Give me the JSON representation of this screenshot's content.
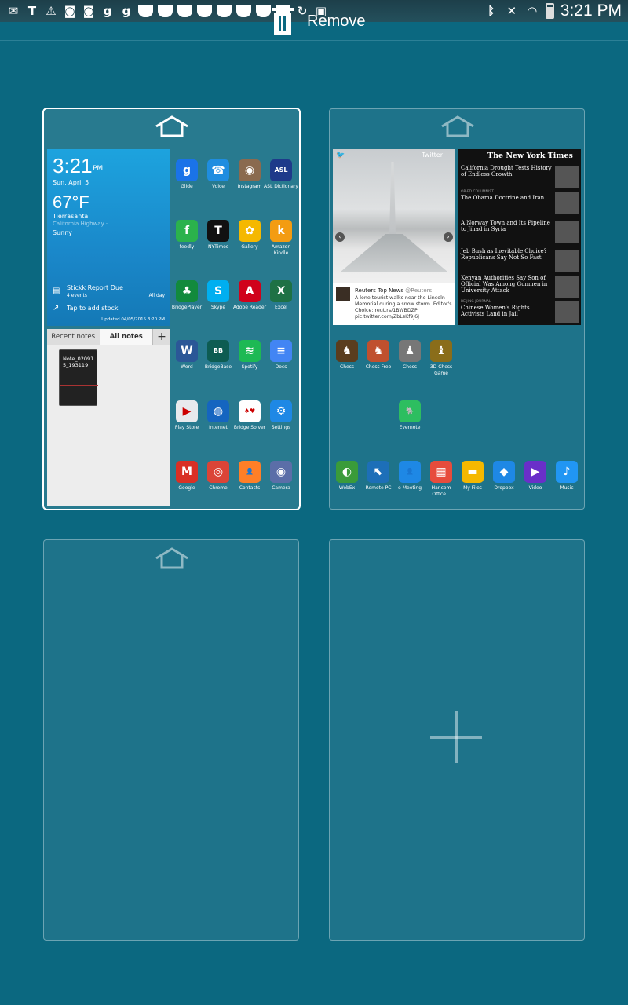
{
  "status_bar": {
    "time": "3:21 PM",
    "notification_icons": [
      "gmail-icon",
      "nytimes-icon",
      "warning-icon",
      "instagram-icon",
      "instagram-icon",
      "glide-icon",
      "glide-icon",
      "cup-icon",
      "cup-icon",
      "cup-icon",
      "cup-icon",
      "cup-icon",
      "cup-icon",
      "cup-icon",
      "cup-icon",
      "sync-icon",
      "clipboard-icon"
    ],
    "system_icons": [
      "bluetooth-icon",
      "mute-icon",
      "wifi-icon",
      "battery-icon"
    ]
  },
  "remove_bar": {
    "label": "Remove"
  },
  "page1": {
    "weather": {
      "time": "3:21",
      "ampm": "PM",
      "date": "Sun, April 5",
      "temp": "67°F",
      "location": "Tierrasanta",
      "location_sub": "California Highway · ...",
      "condition": "Sunny",
      "event_title": "Stickk Report Due",
      "event_count": "4 events",
      "event_time": "All day",
      "stock_prompt": "Tap to add stock",
      "updated": "Updated 04/05/2015 3:20 PM"
    },
    "notes": {
      "tab_recent": "Recent notes",
      "tab_all": "All notes",
      "add": "+",
      "note_title": "Note_020915_193119"
    },
    "apps": [
      {
        "label": "Glide",
        "icon": "glide-icon",
        "glyph": "g",
        "color": "#1a73e8"
      },
      {
        "label": "Voice",
        "icon": "voice-icon",
        "glyph": "☎",
        "color": "#1f8de0"
      },
      {
        "label": "Instagram",
        "icon": "instagram-icon",
        "glyph": "◉",
        "color": "#8a6a4f"
      },
      {
        "label": "ASL Dictionary",
        "icon": "asl-icon",
        "glyph": "ASL",
        "color": "#1e3a8a"
      },
      {
        "label": "feedly",
        "icon": "feedly-icon",
        "glyph": "f",
        "color": "#2bb24c"
      },
      {
        "label": "NYTimes",
        "icon": "nytimes-icon",
        "glyph": "T",
        "color": "#111111"
      },
      {
        "label": "Gallery",
        "icon": "gallery-icon",
        "glyph": "✿",
        "color": "#f5b800"
      },
      {
        "label": "Amazon Kindle",
        "icon": "kindle-icon",
        "glyph": "k",
        "color": "#f39c12"
      },
      {
        "label": "BridgePlayer",
        "icon": "bridgeplayer-icon",
        "glyph": "♣",
        "color": "#128a3c"
      },
      {
        "label": "Skype",
        "icon": "skype-icon",
        "glyph": "S",
        "color": "#00aff0"
      },
      {
        "label": "Adobe Reader",
        "icon": "adobe-icon",
        "glyph": "A",
        "color": "#d0021b"
      },
      {
        "label": "Excel",
        "icon": "excel-icon",
        "glyph": "X",
        "color": "#1e7145"
      },
      {
        "label": "Word",
        "icon": "word-icon",
        "glyph": "W",
        "color": "#2b5797"
      },
      {
        "label": "BridgeBase",
        "icon": "bridgebase-icon",
        "glyph": "BB",
        "color": "#0d5c52"
      },
      {
        "label": "Spotify",
        "icon": "spotify-icon",
        "glyph": "≋",
        "color": "#1db954"
      },
      {
        "label": "Docs",
        "icon": "docs-icon",
        "glyph": "≡",
        "color": "#4285f4"
      },
      {
        "label": "Play Store",
        "icon": "playstore-icon",
        "glyph": "▶",
        "color": "#e8eaed"
      },
      {
        "label": "Internet",
        "icon": "internet-icon",
        "glyph": "◍",
        "color": "#1565c0"
      },
      {
        "label": "Bridge Solver",
        "icon": "bridgesolver-icon",
        "glyph": "♠♥",
        "color": "#ffffff"
      },
      {
        "label": "Settings",
        "icon": "settings-icon",
        "glyph": "⚙",
        "color": "#1e88e5"
      },
      {
        "label": "Google",
        "icon": "gmail-icon",
        "glyph": "M",
        "color": "#d93025"
      },
      {
        "label": "Chrome",
        "icon": "chrome-icon",
        "glyph": "◎",
        "color": "#db4437"
      },
      {
        "label": "Contacts",
        "icon": "contacts-icon",
        "glyph": "👤",
        "color": "#ff7f27"
      },
      {
        "label": "Camera",
        "icon": "camera-icon",
        "glyph": "◉",
        "color": "#5b6ea8"
      }
    ]
  },
  "page2": {
    "twitter": {
      "header": "Twitter",
      "account": "Reuters Top News",
      "handle": "@Reuters",
      "text": "A lone tourist walks near the Lincoln Memorial during a snow storm. Editor's Choice: reut.rs/1BWBDZP pic.twitter.com/ZbLsKf9j6J"
    },
    "nyt": {
      "masthead": "The New York Times",
      "items": [
        {
          "headline": "California Drought Tests History of Endless Growth",
          "meta": ""
        },
        {
          "headline": "The Obama Doctrine and Iran",
          "meta": "OP-ED COLUMNIST"
        },
        {
          "headline": "A Norway Town and Its Pipeline to Jihad in Syria",
          "meta": ""
        },
        {
          "headline": "Jeb Bush as Inevitable Choice? Republicans Say Not So Fast",
          "meta": ""
        },
        {
          "headline": "Kenyan Authorities Say Son of Official Was Among Gunmen in University Attack",
          "meta": ""
        },
        {
          "headline": "Chinese Women's Rights Activists Land in Jail",
          "meta": "BEIJING JOURNAL"
        }
      ]
    },
    "apps_top": [
      {
        "label": "Chess",
        "icon": "chess-icon",
        "glyph": "♞",
        "color": "#5a3d1e"
      },
      {
        "label": "Chess Free",
        "icon": "chessfree-icon",
        "glyph": "♞",
        "color": "#c0502e"
      },
      {
        "label": "Chess",
        "icon": "chess2-icon",
        "glyph": "♟",
        "color": "#777777"
      },
      {
        "label": "3D Chess Game",
        "icon": "chess3d-icon",
        "glyph": "♝",
        "color": "#8a6d1a"
      }
    ],
    "apps_mid": [
      {
        "label": "Evernote",
        "icon": "evernote-icon",
        "glyph": "🐘",
        "color": "#2dbe60"
      }
    ],
    "apps_dock": [
      {
        "label": "WebEx",
        "icon": "webex-icon",
        "glyph": "◐",
        "color": "#3a9b3a"
      },
      {
        "label": "Remote PC",
        "icon": "remotepc-icon",
        "glyph": "⬉",
        "color": "#1d6fb8"
      },
      {
        "label": "e-Meeting",
        "icon": "emeeting-icon",
        "glyph": "👤",
        "color": "#1e88e5"
      },
      {
        "label": "Hancom Office...",
        "icon": "hancom-icon",
        "glyph": "▦",
        "color": "#e74c3c"
      },
      {
        "label": "My Files",
        "icon": "myfiles-icon",
        "glyph": "▬",
        "color": "#f5b800"
      },
      {
        "label": "Dropbox",
        "icon": "dropbox-icon",
        "glyph": "◆",
        "color": "#1e88e5"
      },
      {
        "label": "Video",
        "icon": "video-icon",
        "glyph": "▶",
        "color": "#6a2fc9"
      },
      {
        "label": "Music",
        "icon": "music-icon",
        "glyph": "♪",
        "color": "#2196f3"
      }
    ]
  },
  "colors": {
    "background": "#0b6880",
    "accent": "#ffffff"
  }
}
